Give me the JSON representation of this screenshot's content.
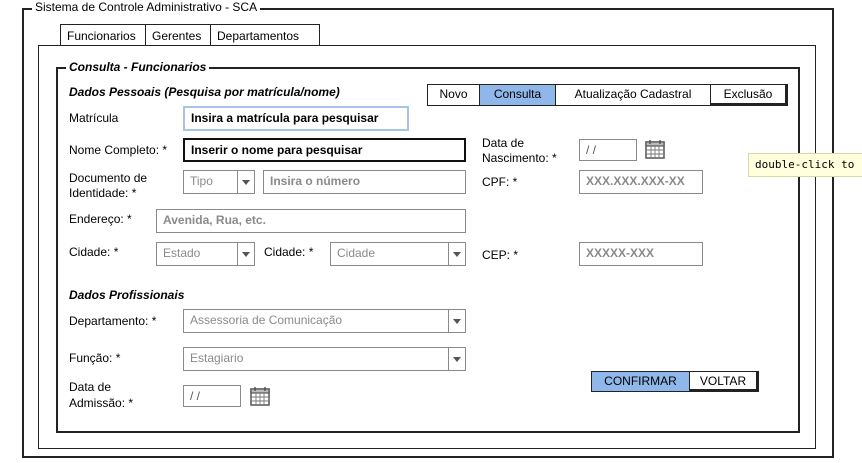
{
  "window": {
    "title": "Sistema de Controle Administrativo - SCA"
  },
  "tabs": [
    {
      "label": "Funcionarios"
    },
    {
      "label": "Gerentes"
    },
    {
      "label": "Departamentos"
    }
  ],
  "panel": {
    "title": "Consulta - Funcionarios"
  },
  "personal": {
    "heading": "Dados Pessoais (Pesquisa por matrícula/nome)",
    "matricula_label": "Matrícula",
    "matricula_value": "Insira a matrícula para pesquisar",
    "nome_label": "Nome Completo: *",
    "nome_value": "Inserir o nome para pesquisar",
    "nasc_label_1": "Data de",
    "nasc_label_2": "Nascimento: *",
    "nasc_value": "/ /",
    "doc_label_1": "Documento de",
    "doc_label_2": "Identidade: *",
    "doc_tipo": "Tipo",
    "doc_numero": "Insira o número",
    "cpf_label": "CPF: *",
    "cpf_value": "XXX.XXX.XXX-XX",
    "endereco_label": "Endereço: *",
    "endereco_value": "Avenida, Rua, etc.",
    "cidade_label": "Cidade: *",
    "estado_value": "Estado",
    "cidade2_label": "Cidade: *",
    "cidade_value": "Cidade",
    "cep_label": "CEP: *",
    "cep_value": "XXXXX-XXX"
  },
  "actions": [
    {
      "label": "Novo"
    },
    {
      "label": "Consulta"
    },
    {
      "label": "Atualização Cadastral"
    },
    {
      "label": "Exclusão"
    }
  ],
  "professional": {
    "heading": "Dados Profissionais",
    "dept_label": "Departamento: *",
    "dept_value": "Assessoria de Comunicação",
    "funcao_label": "Função: *",
    "funcao_value": "Estagiario",
    "adm_label_1": "Data de",
    "adm_label_2": "Admissão: *",
    "adm_value": "/ /"
  },
  "buttons": {
    "confirm": "CONFIRMAR",
    "back": "VOLTAR"
  },
  "tooltip": {
    "text": "double-click to"
  },
  "colors": {
    "accent": "#8fb7ea",
    "focus": "#a7c4e6",
    "muted": "#8a8a8a"
  }
}
